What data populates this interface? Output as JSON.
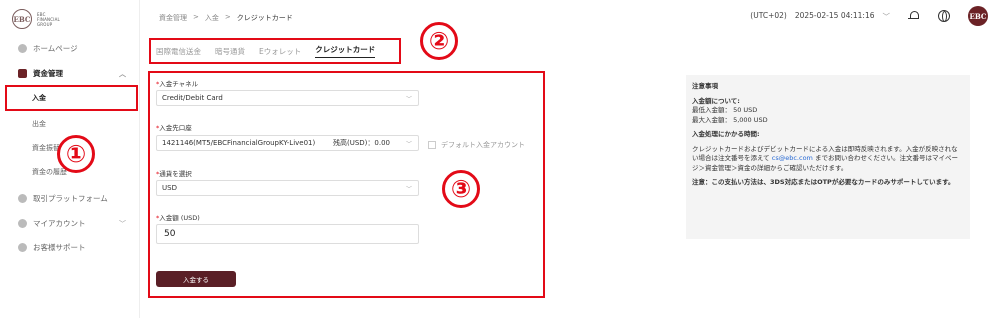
{
  "logo": {
    "mark": "EBC",
    "line1": "EBC",
    "line2": "FINANCIAL",
    "line3": "GROUP"
  },
  "sidebar": {
    "home": "ホームページ",
    "funds": "資金管理",
    "deposit": "入金",
    "withdraw": "出金",
    "transfer": "資金振替",
    "history": "資金の履歴",
    "platform": "取引プラットフォーム",
    "account": "マイアカウント",
    "support": "お客様サポート"
  },
  "breadcrumb": {
    "root": "資金管理",
    "sep1": ">",
    "mid": "入金",
    "sep2": ">",
    "current": "クレジットカード"
  },
  "header": {
    "timezone": "(UTC+02)",
    "datetime": "2025-02-15 04:11:16",
    "avatar": "EBC"
  },
  "tabs": {
    "t1": "国際電信送金",
    "t2": "暗号通貨",
    "t3": "Eウォレット",
    "t4": "クレジットカード"
  },
  "form": {
    "channel_label": "入金チャネル",
    "channel_value": "Credit/Debit Card",
    "dest_label": "入金先口座",
    "dest_value": "1421146(MT5/EBCFinancialGroupKY-Live01)",
    "balance": "残高(USD)：0.00",
    "default_label": "デフォルト入金アカウント",
    "currency_label": "通貨を選択",
    "currency_value": "USD",
    "amount_label": "入金額 (USD)",
    "amount_value": "50",
    "submit": "入金する",
    "req": "*"
  },
  "notes": {
    "title": "注意事項",
    "amount_h": "入金額について:",
    "min": "最低入金額： 50 USD",
    "max": "最大入金額： 5,000 USD",
    "time_h": "入金処理にかかる時間:",
    "body1": "クレジットカードおよびデビットカードによる入金は即時反映されます。入金が反映されない場合は注文番号を添えて",
    "email": "cs@ebc.com",
    "body2": "までお問い合わせください。注文番号はマイページ＞資金管理＞資金の詳細からご確認いただけます。",
    "warn": "注意：この支払い方法は、3DS対応またはOTPが必要なカードのみサポートしています。"
  },
  "markers": {
    "m1": "①",
    "m2": "②",
    "m3": "③"
  },
  "colors": {
    "brand": "#6b2226",
    "marker": "#e30a17",
    "link": "#2a6cd6"
  },
  "icons": [
    "home-icon",
    "wallet-icon",
    "platform-icon",
    "user-icon",
    "support-icon",
    "bell-icon",
    "globe-icon"
  ]
}
